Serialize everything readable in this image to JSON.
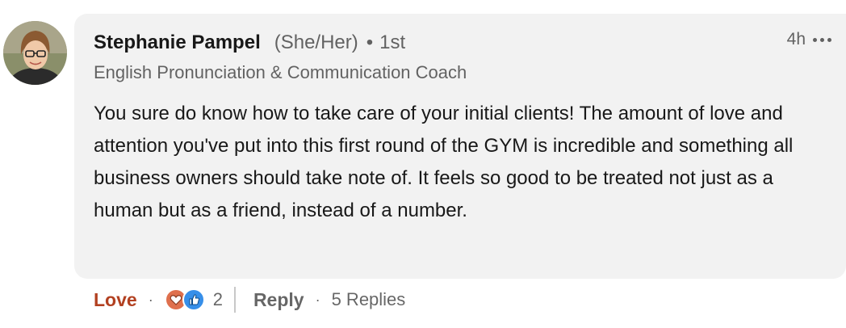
{
  "comment": {
    "author": {
      "name": "Stephanie Pampel",
      "pronouns": "(She/Her)",
      "separator": "•",
      "degree": "1st",
      "headline": "English Pronunciation & Communication Coach",
      "avatar_icon": "profile-photo"
    },
    "timestamp": "4h",
    "more_icon": "ellipsis-icon",
    "text": "You sure do know how to take care of your initial clients! The amount of love and attention you've put into this first round of the GYM is incredible and something all business owners should take note of. It feels so good to be treated not just as a human but as a friend, instead of a number."
  },
  "actions": {
    "reaction_label": "Love",
    "separator": "·",
    "reaction_icons": [
      "love-reaction-icon",
      "like-reaction-icon"
    ],
    "reaction_count": "2",
    "reply_label": "Reply",
    "replies_label": "5 Replies"
  },
  "colors": {
    "bubble_bg": "#f2f2f2",
    "love": "#b24020",
    "like_blue": "#378fe9",
    "love_red": "#df704d"
  }
}
